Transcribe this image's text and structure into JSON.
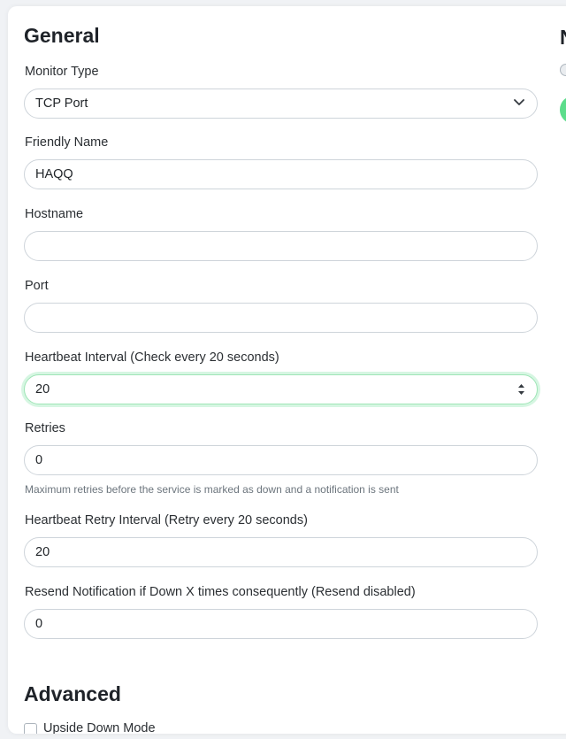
{
  "sections": {
    "general_title": "General",
    "advanced_title": "Advanced",
    "right_title_partial": "N"
  },
  "form": {
    "monitor_type": {
      "label": "Monitor Type",
      "value": "TCP Port"
    },
    "friendly_name": {
      "label": "Friendly Name",
      "value": "HAQQ"
    },
    "hostname": {
      "label": "Hostname",
      "value": ""
    },
    "port": {
      "label": "Port",
      "value": ""
    },
    "heartbeat_interval": {
      "label": "Heartbeat Interval (Check every 20 seconds)",
      "value": "20"
    },
    "retries": {
      "label": "Retries",
      "value": "0",
      "hint": "Maximum retries before the service is marked as down and a notification is sent"
    },
    "heartbeat_retry_interval": {
      "label": "Heartbeat Retry Interval (Retry every 20 seconds)",
      "value": "20"
    },
    "resend_notification": {
      "label": "Resend Notification if Down X times consequently (Resend disabled)",
      "value": "0"
    },
    "upside_down": {
      "label": "Upside Down Mode",
      "checked": false
    }
  },
  "colors": {
    "accent": "#5cdd8b",
    "focus_border": "#9ee5b6"
  }
}
